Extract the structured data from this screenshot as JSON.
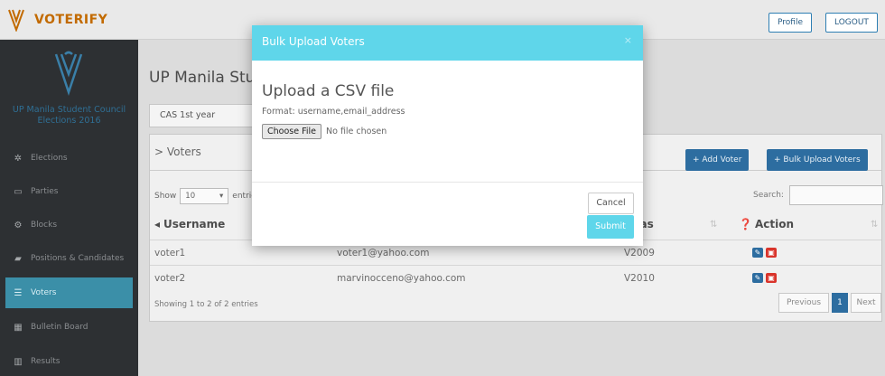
{
  "app": {
    "brand": "VOTERIFY",
    "profile_label": "Profile",
    "logout_label": "LOGOUT"
  },
  "sidebar": {
    "title_line1": "UP Manila Student Council",
    "title_line2": "Elections 2016",
    "items": [
      {
        "label": "Elections",
        "icon": "cogs-icon"
      },
      {
        "label": "Parties",
        "icon": "monitor-icon"
      },
      {
        "label": "Blocks",
        "icon": "cogs-small-icon"
      },
      {
        "label": "Positions & Candidates",
        "icon": "folder-icon"
      },
      {
        "label": "Voters",
        "icon": "list-icon"
      },
      {
        "label": "Bulletin Board",
        "icon": "grid-icon"
      },
      {
        "label": "Results",
        "icon": "bar-chart-icon"
      }
    ],
    "active_index": 4
  },
  "main": {
    "page_title": "UP Manila Student Council Elections 2016",
    "semester": "CAS 1st year",
    "panel_title": "> Voters",
    "add_voter_label": "+ Add Voter",
    "bulk_upload_label": "+ Bulk Upload Voters",
    "show_label": "Show",
    "show_value": "10",
    "entries_label": "entries",
    "search_label": "Search:",
    "columns": {
      "username": "Username",
      "alias": "Alias",
      "action": "Action"
    },
    "rows": [
      {
        "username": "voter1",
        "email": "voter1@yahoo.com",
        "alias": "V2009"
      },
      {
        "username": "voter2",
        "email": "marvinocceno@yahoo.com",
        "alias": "V2010"
      }
    ],
    "info_text": "Showing 1 to 2 of 2 entries",
    "pager": {
      "previous": "Previous",
      "current": "1",
      "next": "Next"
    }
  },
  "modal": {
    "title": "Bulk Upload Voters",
    "close_glyph": "×",
    "heading": "Upload a CSV file",
    "format_text": "Format: username,email_address",
    "choose_file_label": "Choose File",
    "no_file_text": "No file chosen",
    "cancel_label": "Cancel",
    "submit_label": "Submit"
  },
  "colors": {
    "brand": "#c26a00",
    "sidebar_bg": "#2d3033",
    "sidebar_active": "#3b8fa8",
    "primary_button": "#2d6da0",
    "modal_accent": "#5fd6ea",
    "delete_red": "#d9342b"
  }
}
